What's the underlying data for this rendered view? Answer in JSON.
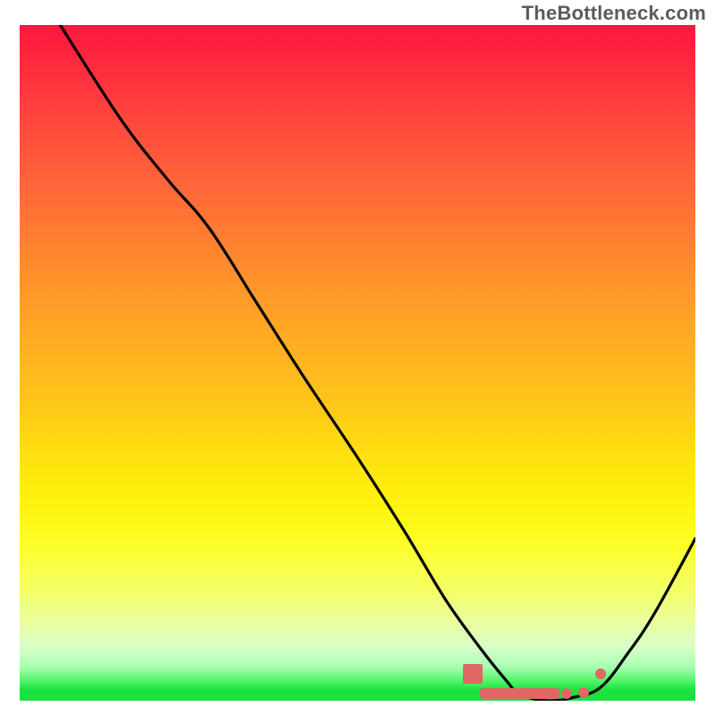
{
  "watermark": "TheBottleneck.com",
  "chart_data": {
    "type": "line",
    "title": "",
    "xlabel": "",
    "ylabel": "",
    "xlim": [
      0,
      100
    ],
    "ylim": [
      0,
      100
    ],
    "legend": false,
    "grid": false,
    "background": "red-yellow-green-vertical-gradient",
    "series": [
      {
        "name": "bottleneck-curve",
        "color": "#000000",
        "x": [
          6,
          15,
          22,
          28,
          35,
          42,
          50,
          57,
          63,
          68,
          72,
          74,
          78,
          82,
          86,
          90,
          94,
          100
        ],
        "y": [
          100,
          86,
          77,
          70,
          59,
          48,
          36,
          25,
          15,
          8,
          3,
          1,
          0,
          0.5,
          2,
          7,
          13,
          24
        ]
      }
    ],
    "annotations": [
      {
        "name": "pink-square-large",
        "x": 67,
        "y": 4,
        "shape": "square",
        "color": "#e16765"
      },
      {
        "name": "pink-bar",
        "x0": 68,
        "x1": 80,
        "y": 1,
        "shape": "bar",
        "color": "#e16765"
      },
      {
        "name": "pink-dot-1",
        "x": 81,
        "y": 1,
        "shape": "dot",
        "color": "#e16765"
      },
      {
        "name": "pink-dot-2",
        "x": 83.5,
        "y": 1.2,
        "shape": "dot",
        "color": "#e16765"
      },
      {
        "name": "pink-dot-3",
        "x": 86,
        "y": 4,
        "shape": "dot",
        "color": "#e16765"
      }
    ]
  }
}
